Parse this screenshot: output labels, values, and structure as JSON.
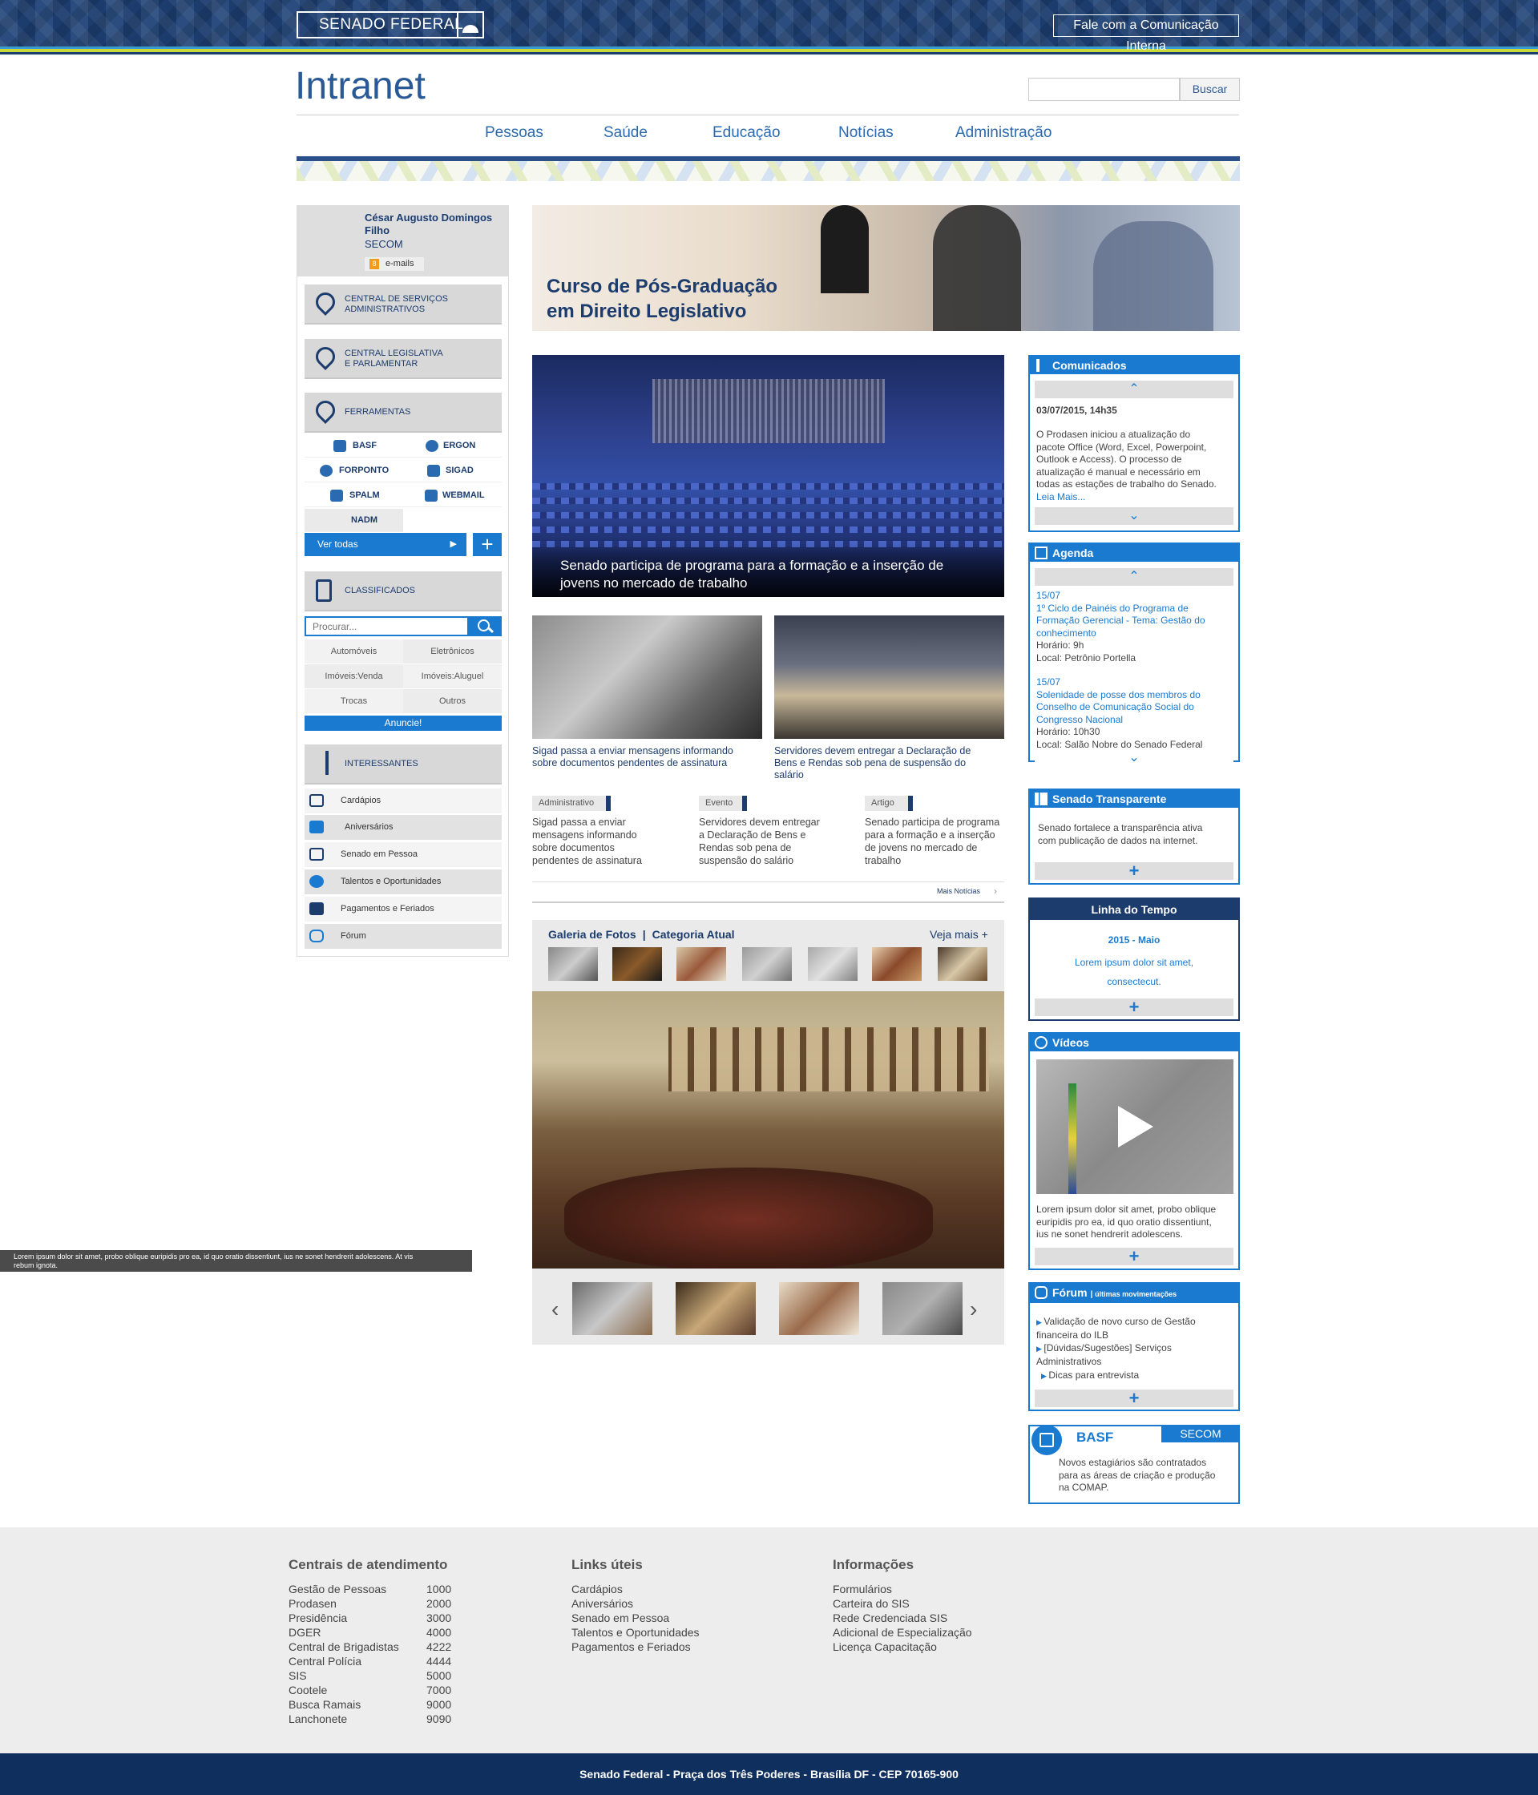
{
  "header": {
    "logo": "SENADO FEDERAL",
    "contact_link": "Fale com a Comunicação Interna",
    "site_title": "Intranet",
    "search_button": "Buscar",
    "search_placeholder": ""
  },
  "nav": [
    "Pessoas",
    "Saúde",
    "Educação",
    "Notícias",
    "Administração"
  ],
  "user": {
    "name_line1": "César Augusto Domingos",
    "name_line2": "Filho",
    "department": "SECOM",
    "email_count": "8",
    "email_label": "e-mails"
  },
  "sidebar": {
    "central_servicos": [
      "CENTRAL DE SERVIÇOS",
      "ADMINISTRATIVOS"
    ],
    "central_legislativa": [
      "CENTRAL LEGISLATIVA",
      "E PARLAMENTAR"
    ],
    "ferramentas": "FERRAMENTAS",
    "tools": [
      "BASF",
      "ERGON",
      "FORPONTO",
      "SIGAD",
      "SPALM",
      "WEBMAIL",
      "NADM"
    ],
    "ver_todas": "Ver todas",
    "classificados": "CLASSIFICADOS",
    "classificados_placeholder": "Procurar...",
    "classificados_cats": [
      "Automóveis",
      "Eletrônicos",
      "Imóveis:Venda",
      "Imóveis:Aluguel",
      "Trocas",
      "Outros"
    ],
    "anuncie": "Anuncie!",
    "interessantes": "INTERESSANTES",
    "interessantes_items": [
      "Cardápios",
      "Aniversários",
      "Senado em Pessoa",
      "Talentos e Oportunidades",
      "Pagamentos e Feriados",
      "Fórum"
    ]
  },
  "banner": {
    "line1": "Curso de Pós-Graduação",
    "line2": "em Direito Legislativo"
  },
  "main_news": {
    "caption_line1": "Senado participa de programa para a formação e a inserção de",
    "caption_line2": "jovens no mercado de trabalho"
  },
  "news": [
    {
      "title_line1": "Sigad passa a enviar mensagens informando",
      "title_line2": "sobre documentos pendentes de assinatura"
    },
    {
      "title_line1": "Servidores devem entregar a Declaração de",
      "title_line2": "Bens e Rendas sob pena de suspensão do",
      "title_line3": "salário"
    }
  ],
  "tagged": [
    {
      "tag": "Administrativo",
      "lines": [
        "Sigad passa a enviar",
        "mensagens informando",
        "sobre documentos",
        "pendentes de assinatura"
      ]
    },
    {
      "tag": "Evento",
      "lines": [
        "Servidores devem entregar",
        "a Declaração de Bens e",
        "Rendas sob pena de",
        "suspensão do salário"
      ]
    },
    {
      "tag": "Artigo",
      "lines": [
        "Senado participa de programa",
        "para a formação e a inserção",
        "de jovens no mercado de",
        "trabalho"
      ]
    }
  ],
  "mais_noticias": "Mais Notícias",
  "gallery": {
    "title": "Galeria de Fotos",
    "category": "Categoria Atual",
    "more": "Veja mais +",
    "caption_line1": "Lorem ipsum dolor sit amet, probo oblique euripidis pro ea, id quo oratio dissentiunt, ius ne sonet hendrerit adolescens. At vis",
    "caption_line2": "rebum ignota."
  },
  "comunicados": {
    "title": "Comunicados",
    "date": "03/07/2015, 14h35",
    "lines": [
      "O Prodasen  iniciou a atualização do",
      "pacote Office (Word, Excel, Powerpoint,",
      "Outlook e Access). O processo de",
      "atualização é manual e necessário em",
      "todas as estações de trabalho do Senado."
    ],
    "link": "Leia Mais..."
  },
  "agenda": {
    "title": "Agenda",
    "events": [
      {
        "date": "15/07",
        "lines": [
          "1º Ciclo de Painéis do Programa de",
          "Formação Gerencial - Tema: Gestão do",
          "conhecimento"
        ],
        "time": "Horário: 9h",
        "place": "Local: Petrônio Portella"
      },
      {
        "date": "15/07",
        "lines": [
          "Solenidade de posse dos membros do",
          "Conselho de Comunicação Social do",
          "Congresso Nacional"
        ],
        "time": "Horário: 10h30",
        "place": "Local: Salão Nobre do Senado Federal"
      }
    ]
  },
  "transparente": {
    "title": "Senado Transparente",
    "lines": [
      "Senado fortalece a transparência ativa",
      "com publicação de dados na internet."
    ]
  },
  "linha_tempo": {
    "title": "Linha do Tempo",
    "date": "2015 - Maio",
    "lines": [
      "Lorem ipsum dolor sit amet,",
      "consectecut."
    ]
  },
  "videos": {
    "title": "Vídeos",
    "lines": [
      "Lorem ipsum dolor sit amet, probo oblique",
      "euripidis pro ea, id quo oratio dissentiunt,",
      "ius ne sonet hendrerit adolescens."
    ]
  },
  "forum": {
    "title": "Fórum",
    "subtitle": "últimas movimentações",
    "items": [
      [
        "Validação de novo curso de Gestão",
        "financeira do ILB"
      ],
      [
        "[Dúvidas/Sugestões] Serviços",
        "Administrativos"
      ],
      [
        "Dicas para entrevista"
      ]
    ]
  },
  "basf": {
    "title": "BASF",
    "tab": "SECOM",
    "lines": [
      "Novos estagiários são contratados",
      "para as áreas de criação e produção",
      "na COMAP."
    ]
  },
  "footer": {
    "centrais_title": "Centrais de atendimento",
    "centrais": [
      [
        "Gestão de Pessoas",
        "1000"
      ],
      [
        "Prodasen",
        "2000"
      ],
      [
        "Presidência",
        "3000"
      ],
      [
        "DGER",
        "4000"
      ],
      [
        "Central de Brigadistas",
        "4222"
      ],
      [
        "Central Polícia",
        "4444"
      ],
      [
        "SIS",
        "5000"
      ],
      [
        "Cootele",
        "7000"
      ],
      [
        "Busca Ramais",
        "9000"
      ],
      [
        "Lanchonete",
        "9090"
      ]
    ],
    "links_title": "Links úteis",
    "links": [
      "Cardápios",
      "Aniversários",
      "Senado em Pessoa",
      "Talentos e Oportunidades",
      "Pagamentos e Feriados"
    ],
    "info_title": "Informações",
    "info": [
      "Formulários",
      "Carteira do SIS",
      "Rede Credenciada SIS",
      "Adicional de Especialização",
      "Licença Capacitação"
    ],
    "address": "Senado Federal - Praça dos Três Poderes - Brasília DF - CEP 70165-900"
  },
  "colors": {
    "primary": "#1c3c6e",
    "accent": "#1a7ad0",
    "banner_title": "#1c3c6e"
  }
}
